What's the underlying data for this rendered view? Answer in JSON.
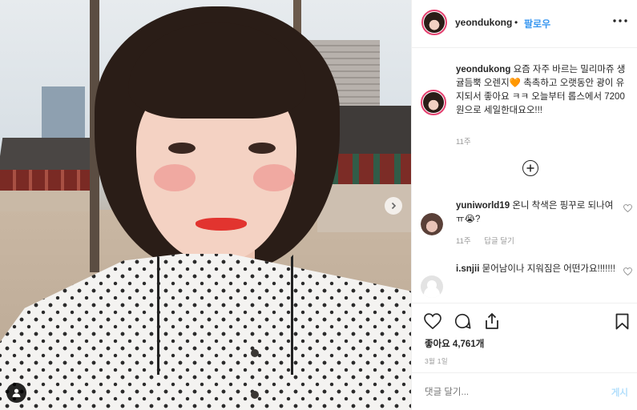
{
  "post": {
    "header": {
      "username": "yeondukong",
      "separator": "•",
      "follow_label": "팔로우",
      "more_icon": "more-horizontal-icon"
    },
    "caption": {
      "username": "yeondukong",
      "text": "요즘 자주 바르는 밀리마쥬 생귤듬뿍 오렌지🧡 촉촉하고 오랫동안 광이 유지되서 좋아요 ㅋㅋ 오늘부터 롭스에서 7200원으로 세일한대요오!!!",
      "time": "11주"
    },
    "comments": [
      {
        "username": "yuniworld19",
        "text": "온니 착색은 핑꾸로 되나여ㅠ😭?",
        "time": "11주",
        "reply_label": "답글 달기"
      },
      {
        "username": "i.snjii",
        "text": "묻어남이나 지워짐은 어떤가요!!!!!!!",
        "time": "",
        "reply_label": ""
      }
    ],
    "likes": "좋아요 4,761개",
    "date": "3월 1일",
    "comment_input": {
      "placeholder": "댓글 달기...",
      "post_label": "게시"
    },
    "icons": {
      "like": "heart-icon",
      "comment": "comment-icon",
      "share": "share-icon",
      "save": "bookmark-icon",
      "load_more": "plus-circle-icon",
      "tag_user": "user-tag-icon",
      "next": "chevron-right-icon"
    },
    "colors": {
      "link": "#3897f0",
      "text": "#262626",
      "muted": "#999999",
      "story_ring": "#e4406f"
    }
  }
}
